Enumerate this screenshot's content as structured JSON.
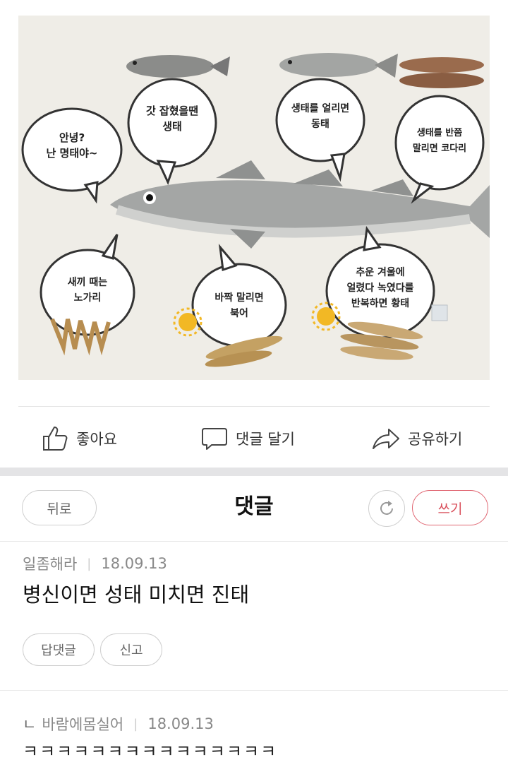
{
  "image": {
    "bubbles": {
      "hello": [
        "안녕?",
        "난 명태야~"
      ],
      "caught": [
        "갓 잡혔을땐",
        "생태"
      ],
      "frozen": [
        "생태를 얼리면",
        "동태"
      ],
      "half_dried": [
        "생태를 반쯤",
        "말리면 코다리"
      ],
      "baby": [
        "새끼 때는",
        "노가리"
      ],
      "dried": [
        "바짝 말리면",
        "북어"
      ],
      "winter": [
        "추운 겨울에",
        "얼렸다 녹였다를",
        "반복하면 황태"
      ]
    }
  },
  "actions": {
    "like": "좋아요",
    "comment": "댓글 달기",
    "share": "공유하기"
  },
  "comments_header": {
    "back": "뒤로",
    "title": "댓글",
    "write": "쓰기"
  },
  "comments": [
    {
      "author": "일좀해라",
      "date": "18.09.13",
      "text": "병신이면 성태 미치면 진태",
      "reply_label": "답댓글",
      "report_label": "신고"
    },
    {
      "prefix": "ㄴ",
      "author": "바람에몸실어",
      "date": "18.09.13",
      "text": "ㅋㅋㅋㅋㅋㅋㅋㅋㅋㅋㅋㅋㅋㅋㅋ"
    }
  ],
  "colors": {
    "accent": "#d9505c",
    "divider": "#e4e4e6",
    "meta": "#888888"
  }
}
